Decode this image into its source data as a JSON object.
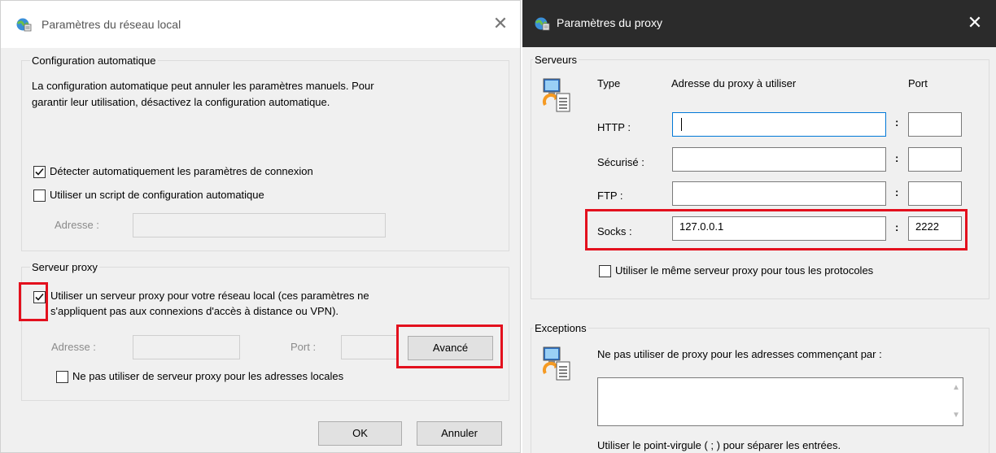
{
  "lan_dialog": {
    "title": "Paramètres du réseau local",
    "close_glyph": "✕",
    "auto_config": {
      "legend": "Configuration automatique",
      "description_line1": "La configuration automatique peut annuler les paramètres manuels. Pour",
      "description_line2": "garantir leur utilisation, désactivez la configuration automatique.",
      "detect_label": "Détecter automatiquement les paramètres de connexion",
      "detect_checked": true,
      "script_label": "Utiliser un script de configuration automatique",
      "script_checked": false,
      "address_label": "Adresse :",
      "address_value": ""
    },
    "proxy_server": {
      "legend": "Serveur proxy",
      "use_proxy_line1": "Utiliser un serveur proxy pour votre réseau local (ces paramètres ne",
      "use_proxy_line2": "s'appliquent pas aux connexions d'accès à distance ou VPN).",
      "use_proxy_checked": true,
      "address_label": "Adresse :",
      "address_value": "",
      "port_label": "Port :",
      "port_value": "",
      "advanced_button": "Avancé",
      "bypass_local_label": "Ne pas utiliser de serveur proxy pour les adresses locales",
      "bypass_local_checked": false
    },
    "ok_button": "OK",
    "cancel_button": "Annuler"
  },
  "proxy_dialog": {
    "title": "Paramètres du proxy",
    "close_glyph": "✕",
    "servers": {
      "legend": "Serveurs",
      "col_type": "Type",
      "col_address": "Adresse du proxy à utiliser",
      "col_port": "Port",
      "colon": ":",
      "rows": [
        {
          "type": "HTTP :",
          "address": "",
          "port": ""
        },
        {
          "type": "Sécurisé :",
          "address": "",
          "port": ""
        },
        {
          "type": "FTP :",
          "address": "",
          "port": ""
        },
        {
          "type": "Socks :",
          "address": "127.0.0.1",
          "port": "2222"
        }
      ],
      "same_proxy_label": "Utiliser le même serveur proxy pour tous les protocoles",
      "same_proxy_checked": false
    },
    "exceptions": {
      "legend": "Exceptions",
      "description": "Ne pas utiliser de proxy pour les adresses commençant par :",
      "value": "",
      "hint": "Utiliser le point-virgule ( ; ) pour séparer les entrées."
    }
  },
  "colors": {
    "highlight": "#e3101d",
    "focus_border": "#0078d7",
    "proxy_titlebar": "#2b2b2b"
  }
}
